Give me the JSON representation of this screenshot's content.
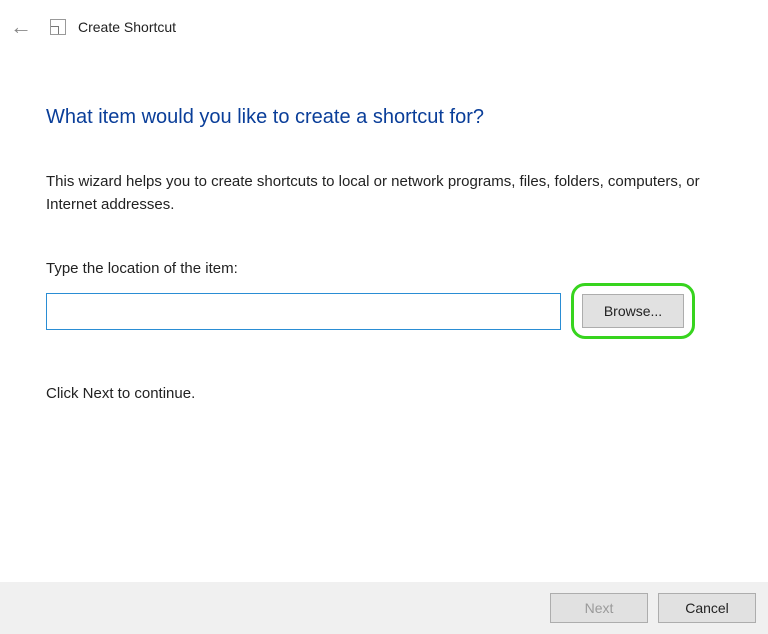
{
  "header": {
    "title": "Create Shortcut"
  },
  "main": {
    "heading": "What item would you like to create a shortcut for?",
    "description": "This wizard helps you to create shortcuts to local or network programs, files, folders, computers, or Internet addresses.",
    "field_label": "Type the location of the item:",
    "location_value": "",
    "browse_label": "Browse...",
    "continue_text": "Click Next to continue."
  },
  "footer": {
    "next_label": "Next",
    "cancel_label": "Cancel"
  }
}
